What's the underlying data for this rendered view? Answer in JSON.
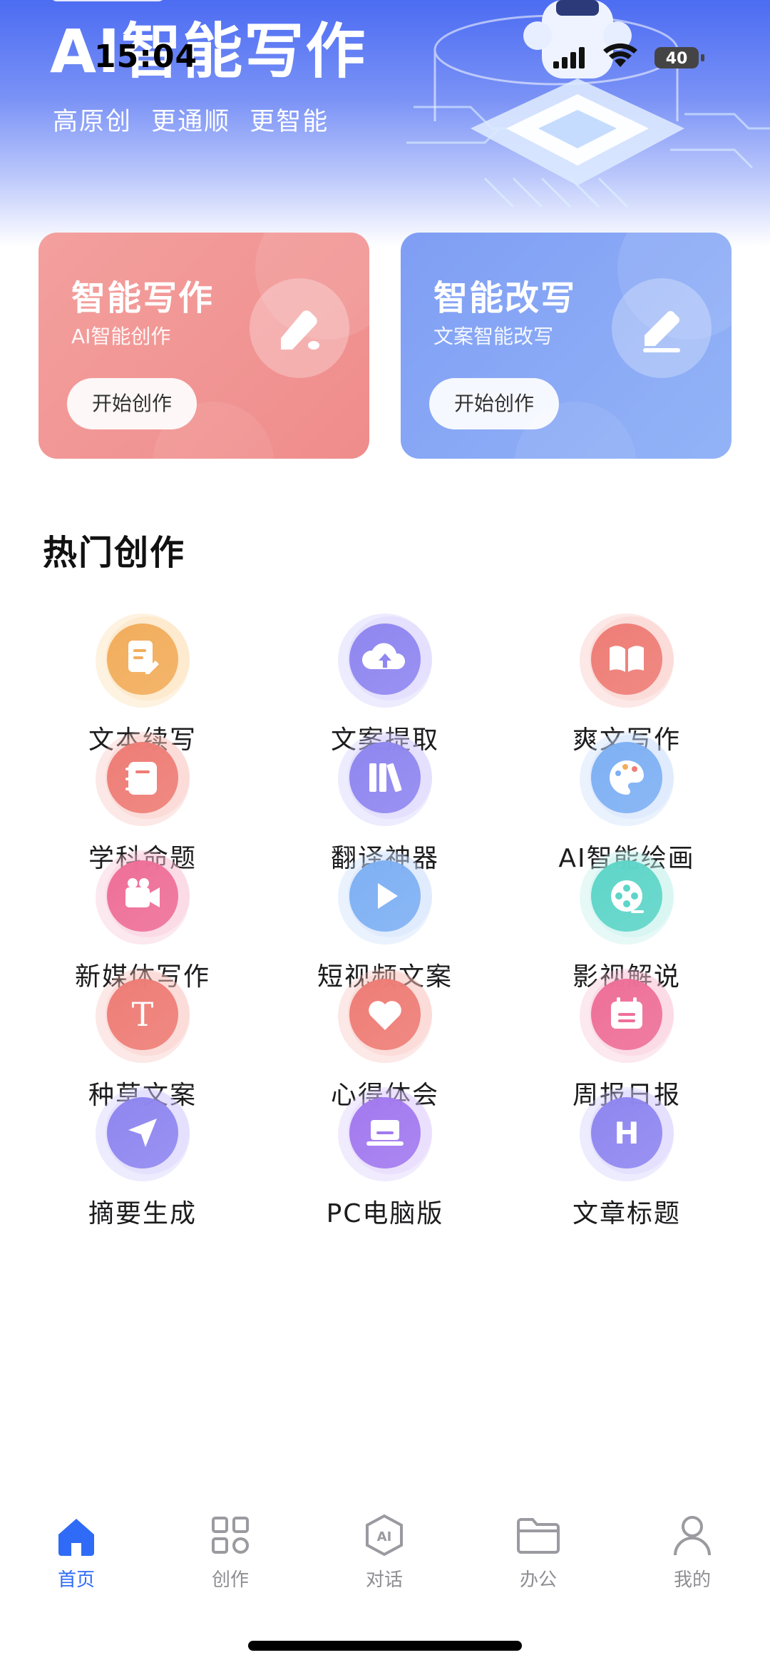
{
  "status_bar": {
    "time": "15:04",
    "battery": "40"
  },
  "header": {
    "title": "AI智能写作",
    "subtitle": "高原创  更通顺  更智能"
  },
  "feature_cards": [
    {
      "title": "智能写作",
      "subtitle": "AI智能创作",
      "button": "开始创作",
      "icon": "pen-icon",
      "color": "#ef8c8b"
    },
    {
      "title": "智能改写",
      "subtitle": "文案智能改写",
      "button": "开始创作",
      "icon": "pencil-icon",
      "color": "#86a6f5"
    }
  ],
  "section": {
    "title": "热门创作"
  },
  "tools": [
    {
      "label": "文本续写",
      "icon": "document-edit-icon",
      "color": "#f2ad5c",
      "halo": "#fbd9a6"
    },
    {
      "label": "文案提取",
      "icon": "cloud-upload-icon",
      "color": "#8f86f0",
      "halo": "#cbc6fb"
    },
    {
      "label": "爽文写作",
      "icon": "open-book-icon",
      "color": "#ee7d76",
      "halo": "#f7bdb8"
    },
    {
      "label": "学科命题",
      "icon": "notebook-icon",
      "color": "#ee7d76",
      "halo": "#f7bdb8"
    },
    {
      "label": "翻译神器",
      "icon": "books-icon",
      "color": "#8f86f0",
      "halo": "#cbc6fb"
    },
    {
      "label": "AI智能绘画",
      "icon": "palette-icon",
      "color": "#7eb0f4",
      "halo": "#c4dafc"
    },
    {
      "label": "新媒体写作",
      "icon": "video-camera-icon",
      "color": "#ee6f98",
      "halo": "#f7bcd0"
    },
    {
      "label": "短视频文案",
      "icon": "play-icon",
      "color": "#7eb0f4",
      "halo": "#c4dafc"
    },
    {
      "label": "影视解说",
      "icon": "film-reel-icon",
      "color": "#5ed5c8",
      "halo": "#b6efe8"
    },
    {
      "label": "种草文案",
      "icon": "letter-t-icon",
      "color": "#ee7d76",
      "halo": "#f7bdb8"
    },
    {
      "label": "心得体会",
      "icon": "heart-icon",
      "color": "#ee7d76",
      "halo": "#f7bdb8"
    },
    {
      "label": "周报日报",
      "icon": "calendar-icon",
      "color": "#ee6f98",
      "halo": "#f7bcd0"
    },
    {
      "label": "摘要生成",
      "icon": "send-arrow-icon",
      "color": "#8f86f0",
      "halo": "#cbc6fb"
    },
    {
      "label": "PC电脑版",
      "icon": "laptop-icon",
      "color": "#a279ef",
      "halo": "#d8c6fb"
    },
    {
      "label": "文章标题",
      "icon": "letter-h-icon",
      "color": "#8f86f0",
      "halo": "#cbc6fb"
    }
  ],
  "tabbar": [
    {
      "label": "首页",
      "icon": "home-icon",
      "active": true
    },
    {
      "label": "创作",
      "icon": "grid-apps-icon",
      "active": false
    },
    {
      "label": "对话",
      "icon": "ai-hexagon-icon",
      "active": false
    },
    {
      "label": "办公",
      "icon": "folder-icon",
      "active": false
    },
    {
      "label": "我的",
      "icon": "user-icon",
      "active": false
    }
  ],
  "colors": {
    "accent": "#2f6bf6",
    "header_gradient_top": "#4c6cf2",
    "tab_inactive": "#8e8e93"
  }
}
